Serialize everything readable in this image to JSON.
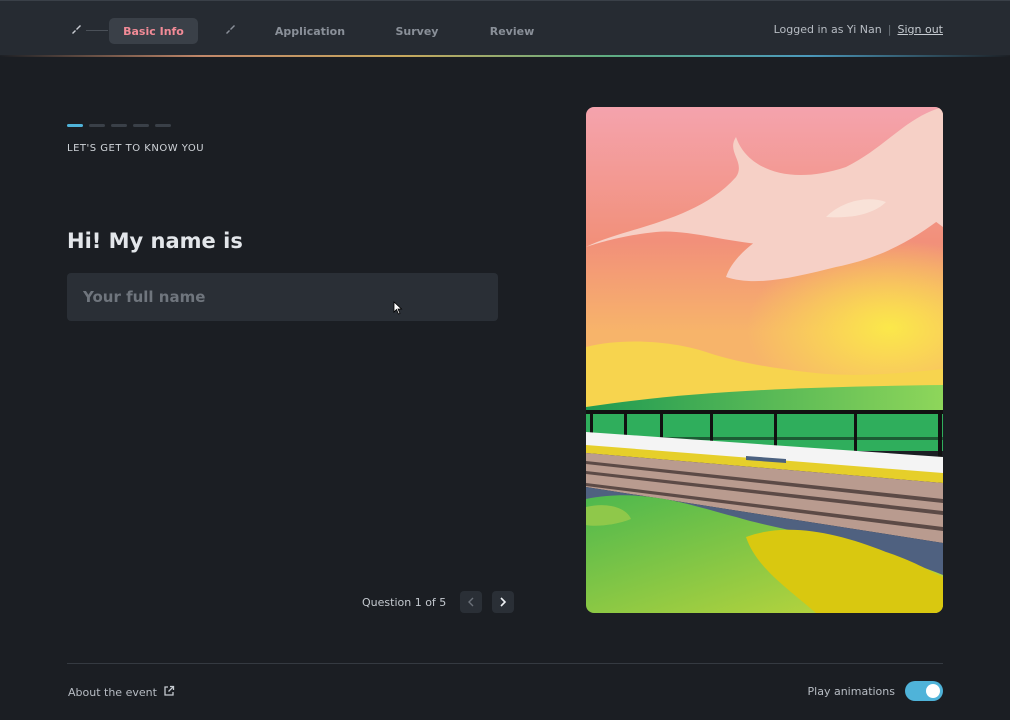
{
  "nav": {
    "tabs": [
      {
        "label": "Basic Info",
        "active": true
      },
      {
        "label": "Application",
        "active": false
      },
      {
        "label": "Survey",
        "active": false
      },
      {
        "label": "Review",
        "active": false
      }
    ],
    "user_text": "Logged in as Yi Nan",
    "separator": "|",
    "signout_label": "Sign out"
  },
  "form": {
    "progress_total": 5,
    "progress_current": 1,
    "eyebrow": "LET'S GET TO KNOW YOU",
    "question": "Hi! My name is",
    "input_placeholder": "Your full name",
    "input_value": "",
    "question_count": "Question 1 of 5"
  },
  "footer": {
    "about_label": "About the event",
    "animations_label": "Play animations",
    "animations_on": true
  },
  "colors": {
    "accent": "#4fb3d9",
    "active_tab_text": "#f28b97",
    "background": "#1b1e23"
  },
  "icons": [
    "brush-icon",
    "chevron-left-icon",
    "chevron-right-icon",
    "external-link-icon",
    "mouse-cursor-icon"
  ]
}
